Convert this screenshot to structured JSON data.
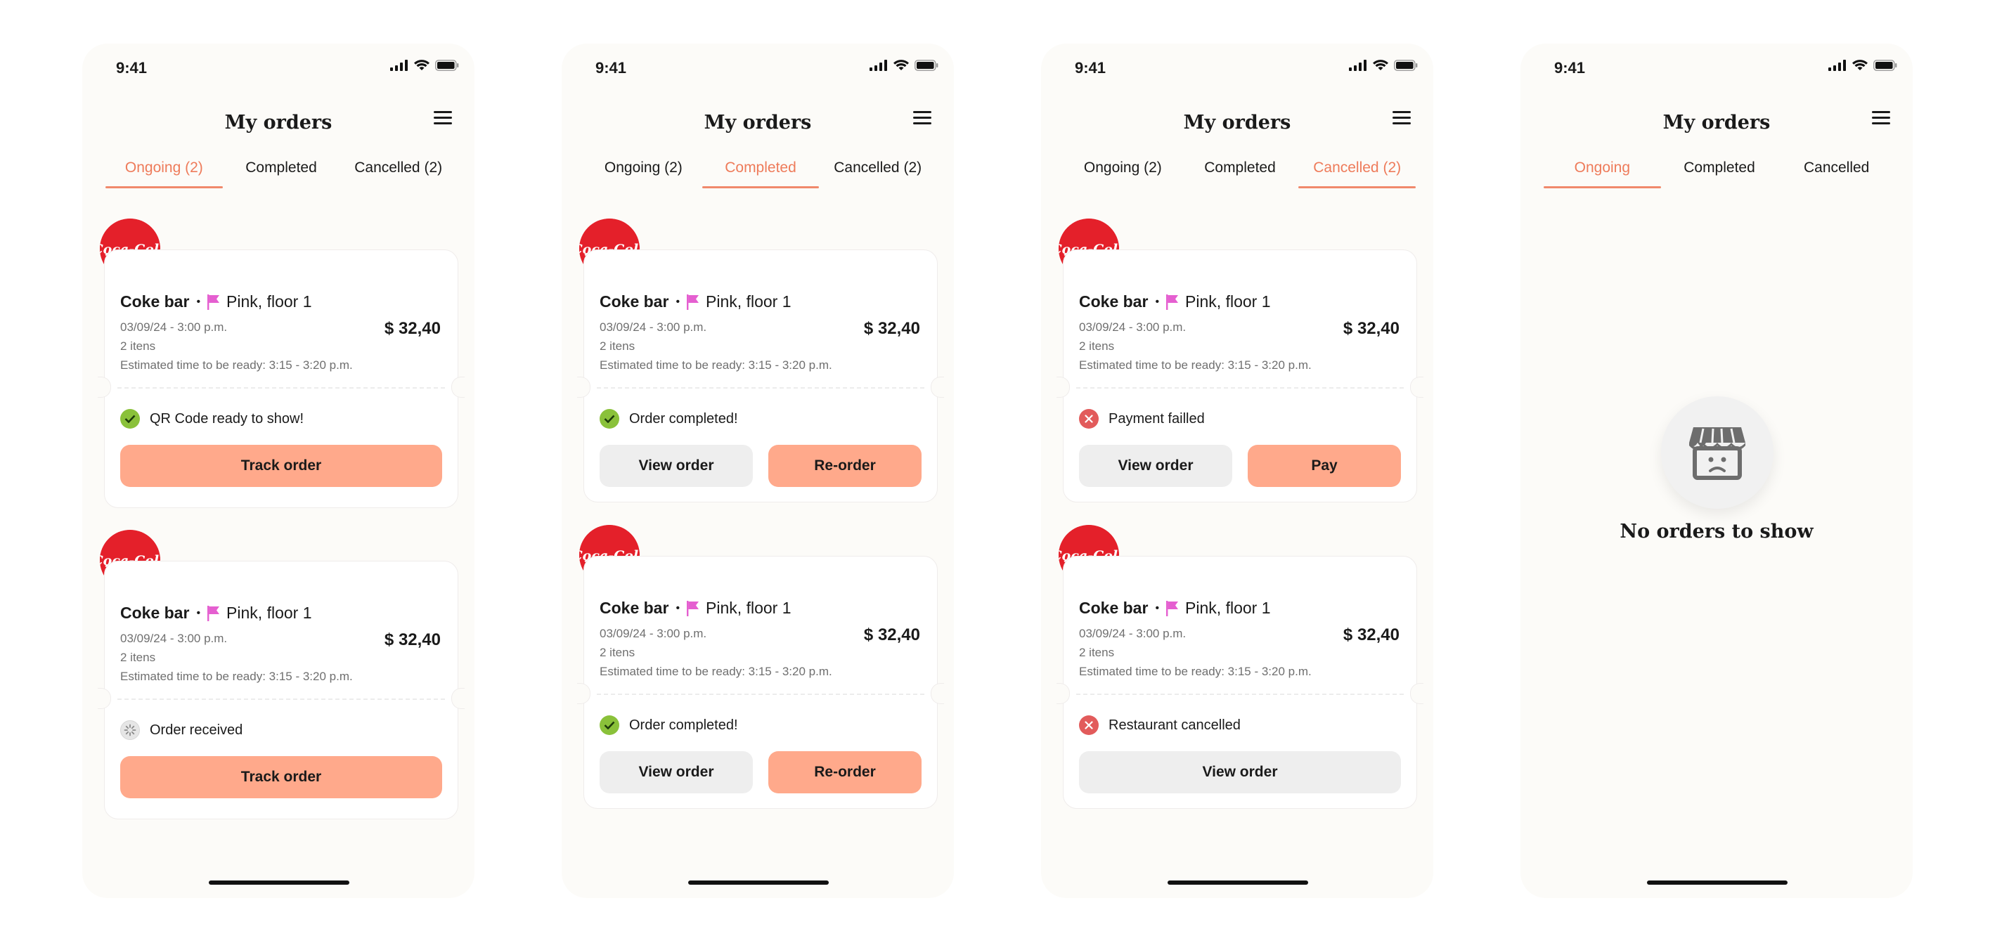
{
  "colors": {
    "accent": "#ee7b5a",
    "primary_button": "#ffa98b",
    "secondary_button": "#eeeeee",
    "success": "#8ac13a",
    "error": "#e25b5b",
    "flag": "#e55fd0",
    "brand": "#e4202a"
  },
  "screens": [
    {
      "time": "9:41",
      "title": "My orders",
      "tabs": [
        "Ongoing (2)",
        "Completed",
        "Cancelled (2)"
      ],
      "active_tab": 0,
      "orders": [
        {
          "brand_logo": "Coca-Cola",
          "vendor": "Coke bar",
          "location": "Pink, floor 1",
          "datetime": "03/09/24 - 3:00 p.m.",
          "items": "2 itens",
          "eta": "Estimated time to be ready: 3:15 - 3:20 p.m.",
          "price": "$ 32,40",
          "status_icon": "check-circle-icon",
          "status": "QR Code ready to show!",
          "buttons": [
            "Track order"
          ]
        },
        {
          "brand_logo": "Coca-Cola",
          "vendor": "Coke bar",
          "location": "Pink, floor 1",
          "datetime": "03/09/24 - 3:00 p.m.",
          "items": "2 itens",
          "eta": "Estimated time to be ready: 3:15 - 3:20 p.m.",
          "price": "$ 32,40",
          "status_icon": "loading-spinner-icon",
          "status": "Order received",
          "buttons": [
            "Track order"
          ]
        }
      ]
    },
    {
      "time": "9:41",
      "title": "My orders",
      "tabs": [
        "Ongoing (2)",
        "Completed",
        "Cancelled (2)"
      ],
      "active_tab": 1,
      "orders": [
        {
          "brand_logo": "Coca-Cola",
          "vendor": "Coke bar",
          "location": "Pink, floor 1",
          "datetime": "03/09/24 - 3:00 p.m.",
          "items": "2 itens",
          "eta": "Estimated time to be ready: 3:15 - 3:20 p.m.",
          "price": "$ 32,40",
          "status_icon": "check-circle-icon",
          "status": "Order completed!",
          "buttons": [
            "View order",
            "Re-order"
          ]
        },
        {
          "brand_logo": "Coca-Cola",
          "vendor": "Coke bar",
          "location": "Pink, floor 1",
          "datetime": "03/09/24 - 3:00 p.m.",
          "items": "2 itens",
          "eta": "Estimated time to be ready: 3:15 - 3:20 p.m.",
          "price": "$ 32,40",
          "status_icon": "check-circle-icon",
          "status": "Order completed!",
          "buttons": [
            "View order",
            "Re-order"
          ]
        }
      ]
    },
    {
      "time": "9:41",
      "title": "My orders",
      "tabs": [
        "Ongoing (2)",
        "Completed",
        "Cancelled (2)"
      ],
      "active_tab": 2,
      "orders": [
        {
          "brand_logo": "Coca-Cola",
          "vendor": "Coke bar",
          "location": "Pink, floor 1",
          "datetime": "03/09/24 - 3:00 p.m.",
          "items": "2 itens",
          "eta": "Estimated time to be ready: 3:15 - 3:20 p.m.",
          "price": "$ 32,40",
          "status_icon": "error-circle-icon",
          "status": "Payment failled",
          "buttons": [
            "View order",
            "Pay"
          ]
        },
        {
          "brand_logo": "Coca-Cola",
          "vendor": "Coke bar",
          "location": "Pink, floor 1",
          "datetime": "03/09/24 - 3:00 p.m.",
          "items": "2 itens",
          "eta": "Estimated time to be ready: 3:15 - 3:20 p.m.",
          "price": "$ 32,40",
          "status_icon": "error-circle-icon",
          "status": "Restaurant cancelled",
          "buttons": [
            "View order"
          ]
        }
      ]
    },
    {
      "time": "9:41",
      "title": "My orders",
      "tabs": [
        "Ongoing",
        "Completed",
        "Cancelled"
      ],
      "active_tab": 0,
      "empty_icon": "sad-store-icon",
      "empty_message": "No orders to show"
    }
  ]
}
